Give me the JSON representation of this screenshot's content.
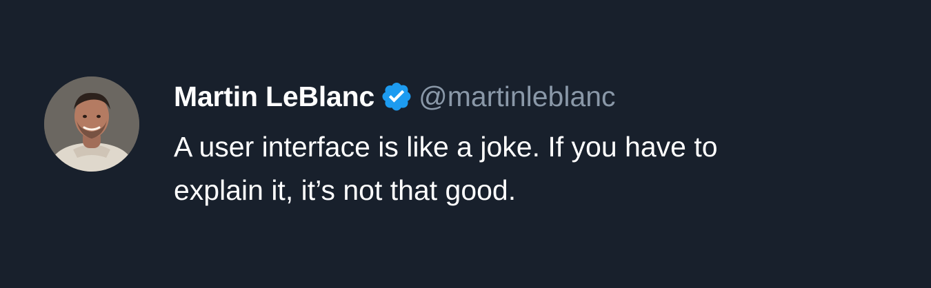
{
  "tweet": {
    "author_name": "Martin LeBlanc",
    "author_handle": "@martinleblanc",
    "verified_icon": "verified-badge-icon",
    "avatar_icon": "avatar",
    "text": "A user interface is like a joke. If you have to\nexplain it, it’s not that good."
  },
  "colors": {
    "background": "#18202c",
    "text_primary": "#ffffff",
    "text_secondary": "#8a98a8",
    "verified_badge": "#1d9bf0"
  }
}
